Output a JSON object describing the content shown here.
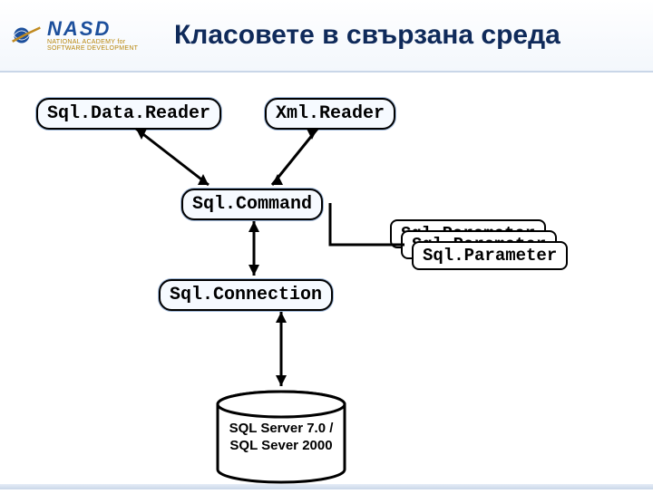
{
  "header": {
    "logo_main": "NASD",
    "logo_sub_top": "NATIONAL ACADEMY for",
    "logo_sub_bottom": "SOFTWARE DEVELOPMENT",
    "title": "Класовете в свързана среда"
  },
  "nodes": {
    "datareader": "Sql.Data.Reader",
    "xmlreader": "Xml.Reader",
    "command": "Sql.Command",
    "connection": "Sql.Connection",
    "parameter": "Sql.Parameter"
  },
  "db": {
    "line1": "SQL Server 7.0 /",
    "line2": "SQL Sever 2000"
  }
}
